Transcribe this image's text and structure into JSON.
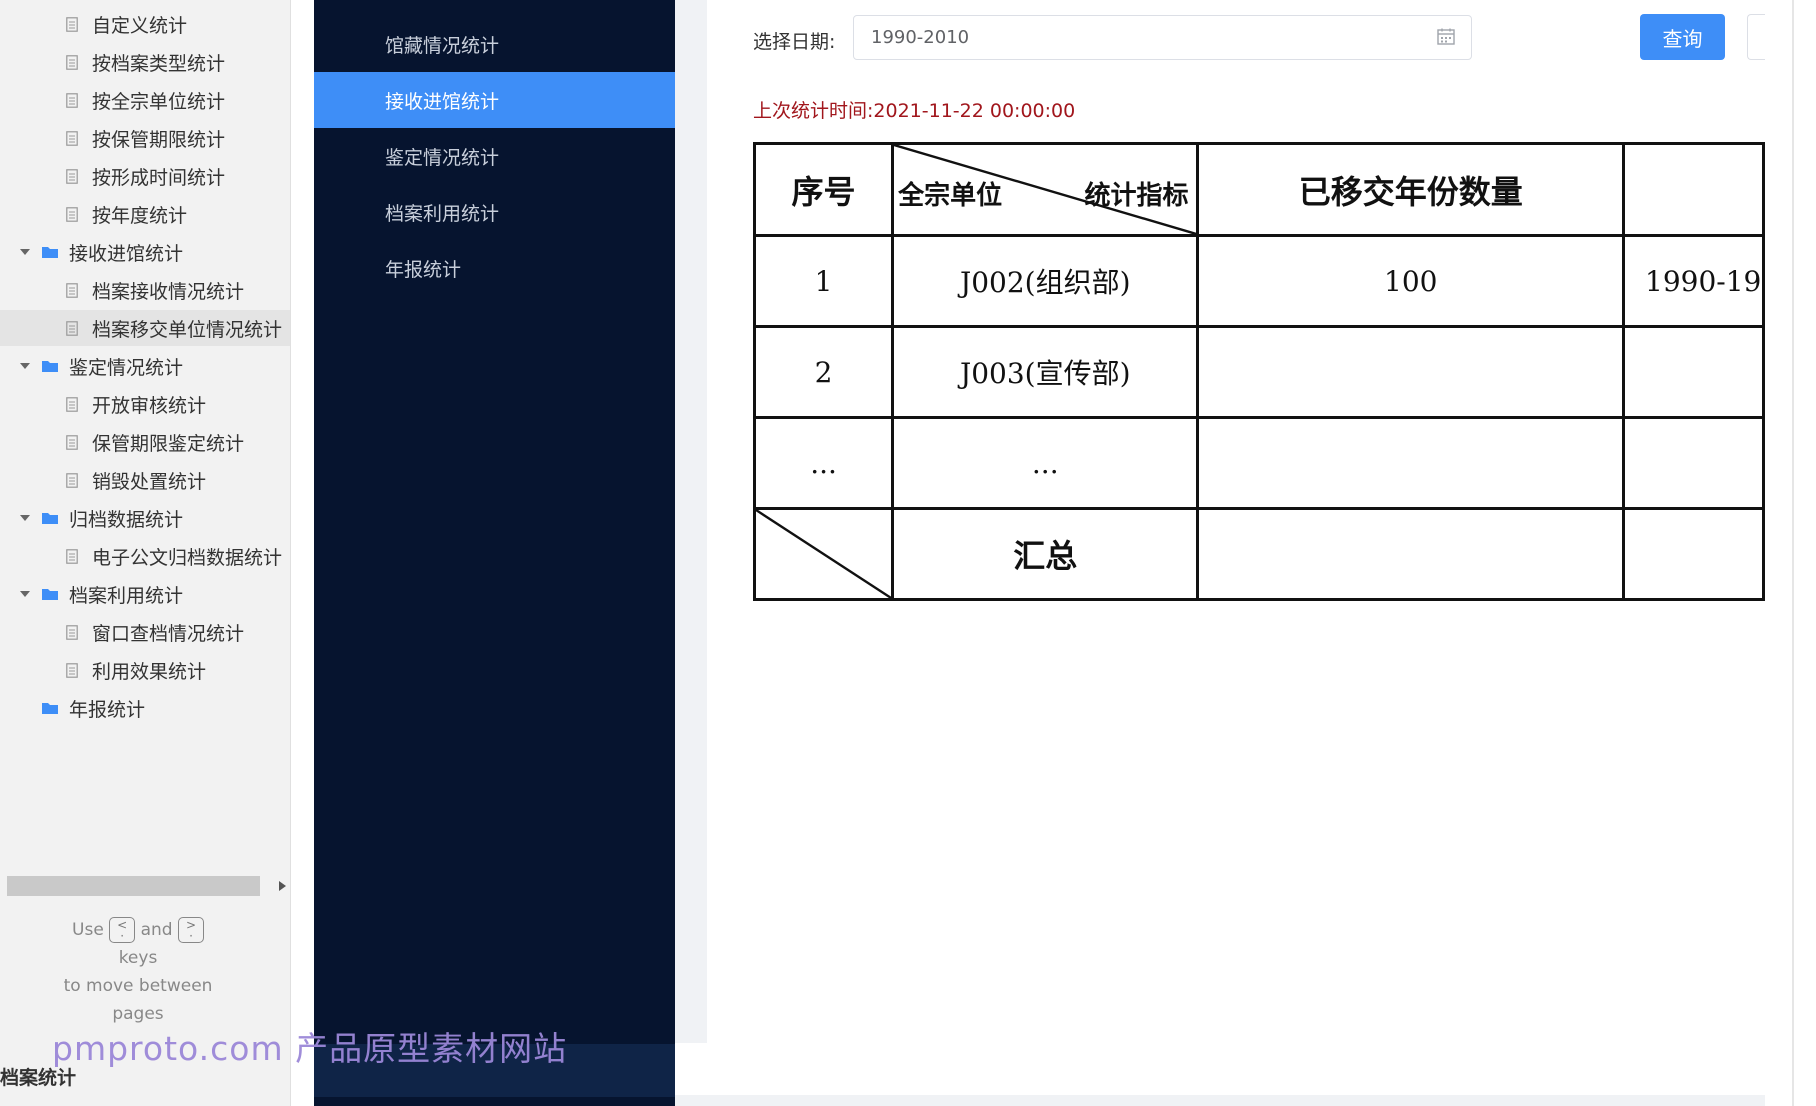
{
  "tree": {
    "items": [
      {
        "label": "自定义统计",
        "level": "child"
      },
      {
        "label": "按档案类型统计",
        "level": "child"
      },
      {
        "label": "按全宗单位统计",
        "level": "child"
      },
      {
        "label": "按保管期限统计",
        "level": "child"
      },
      {
        "label": "按形成时间统计",
        "level": "child"
      },
      {
        "label": "按年度统计",
        "level": "child"
      },
      {
        "label": "接收进馆统计",
        "level": "folder",
        "expanded": true
      },
      {
        "label": "档案接收情况统计",
        "level": "child"
      },
      {
        "label": "档案移交单位情况统计",
        "level": "child",
        "selected": true
      },
      {
        "label": "鉴定情况统计",
        "level": "folder",
        "expanded": true
      },
      {
        "label": "开放审核统计",
        "level": "child"
      },
      {
        "label": "保管期限鉴定统计",
        "level": "child"
      },
      {
        "label": "销毁处置统计",
        "level": "child"
      },
      {
        "label": "归档数据统计",
        "level": "folder",
        "expanded": true
      },
      {
        "label": "电子公文归档数据统计",
        "level": "child"
      },
      {
        "label": "档案利用统计",
        "level": "folder",
        "expanded": true
      },
      {
        "label": "窗口查档情况统计",
        "level": "child"
      },
      {
        "label": "利用效果统计",
        "level": "child"
      },
      {
        "label": "年报统计",
        "level": "folder",
        "expanded": false
      }
    ],
    "hint": {
      "use": "Use",
      "and": "and",
      "keys": "keys",
      "move": "to move between",
      "pages": "pages",
      "prev_key": "<",
      "next_key": ">"
    },
    "section_title": "档案统计"
  },
  "nav": {
    "items": [
      {
        "label": "馆藏情况统计",
        "active": false
      },
      {
        "label": "接收进馆统计",
        "active": true
      },
      {
        "label": "鉴定情况统计",
        "active": false
      },
      {
        "label": "档案利用统计",
        "active": false
      },
      {
        "label": "年报统计",
        "active": false
      }
    ]
  },
  "filter": {
    "date_label": "选择日期:",
    "date_value": "1990-2010",
    "query_label": "查询"
  },
  "last_stat": "上次统计时间:2021-11-22 00:00:00",
  "table": {
    "headers": {
      "seq": "序号",
      "unit": "全宗单位",
      "indicator": "统计指标",
      "years_count": "已移交年份数量"
    },
    "rows": [
      {
        "seq": "1",
        "unit": "J002(组织部)",
        "years_count": "100",
        "range": "1990-19"
      },
      {
        "seq": "2",
        "unit": "J003(宣传部)",
        "years_count": "",
        "range": ""
      },
      {
        "seq": "...",
        "unit": "...",
        "years_count": "",
        "range": ""
      }
    ],
    "summary": "汇总"
  },
  "watermark": "pmproto.com 产品原型素材网站",
  "colors": {
    "nav_bg": "#06142f",
    "accent": "#3e8ef7",
    "last_stat_text": "#a1161c",
    "tree_bg": "#f2f2f2",
    "watermark": "#9b87d8"
  }
}
